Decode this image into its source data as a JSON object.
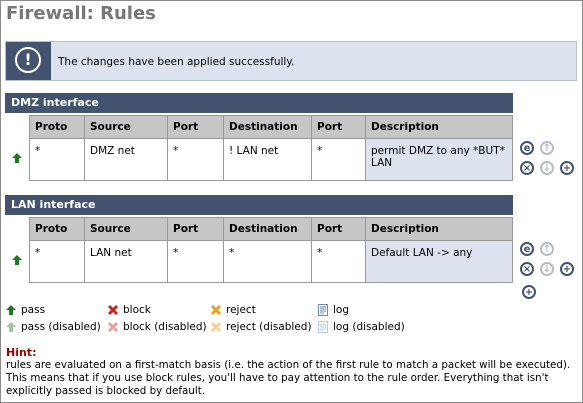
{
  "page": {
    "title": "Firewall: Rules"
  },
  "notice": {
    "message": "The changes have been applied successfully.",
    "icon": "info-icon"
  },
  "tables": [
    {
      "header": "DMZ interface",
      "columns": [
        "Proto",
        "Source",
        "Port",
        "Destination",
        "Port",
        "Description"
      ],
      "rows": [
        {
          "status": "pass",
          "cells": [
            "*",
            "DMZ net",
            "*",
            "! LAN net",
            "*",
            "permit DMZ to any *BUT* LAN"
          ]
        }
      ]
    },
    {
      "header": "LAN interface",
      "columns": [
        "Proto",
        "Source",
        "Port",
        "Destination",
        "Port",
        "Description"
      ],
      "rows": [
        {
          "status": "pass",
          "cells": [
            "*",
            "LAN net",
            "*",
            "*",
            "*",
            "Default LAN -> any"
          ]
        }
      ]
    }
  ],
  "actions": {
    "edit": "e",
    "up": "up",
    "delete": "x",
    "down": "down",
    "add": "+"
  },
  "legend": {
    "pass": "pass",
    "block": "block",
    "reject": "reject",
    "log": "log",
    "pass_disabled": "pass (disabled)",
    "block_disabled": "block (disabled)",
    "reject_disabled": "reject (disabled)",
    "log_disabled": "log (disabled)"
  },
  "hint": {
    "title": "Hint:",
    "text": "rules are evaluated on a first-match basis (i.e. the action of the first rule to match a packet will be executed). This means that if you use block rules, you'll have to pay attention to the rule order. Everything that isn't explicitly passed is blocked by default."
  },
  "colors": {
    "header": "#435370",
    "pass": "#1f7a1f",
    "block": "#cc2222",
    "reject": "#e8a020",
    "hint": "#990000",
    "highlight": "#dde3ee"
  }
}
